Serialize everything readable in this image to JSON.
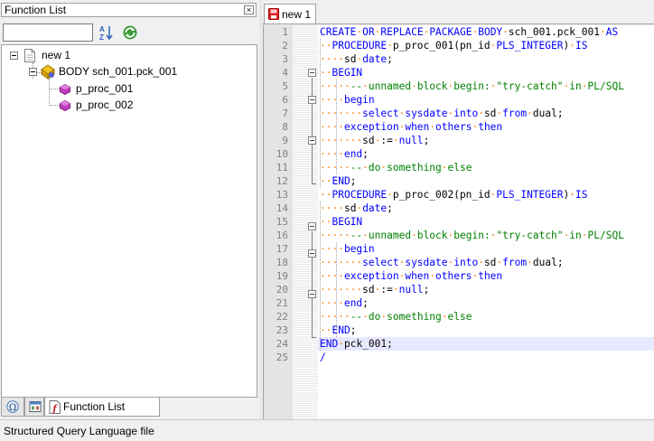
{
  "function_list": {
    "title": "Function List",
    "close_glyph": "×",
    "search": {
      "value": "",
      "placeholder": ""
    },
    "sort_icon": "sort-az-icon",
    "refresh_icon": "refresh-icon",
    "tree": {
      "root": {
        "label": "new 1",
        "icon": "document-icon"
      },
      "package": {
        "label": "BODY sch_001.pck_001",
        "icon": "package-body-icon"
      },
      "procedures": [
        {
          "label": "p_proc_001",
          "icon": "procedure-icon"
        },
        {
          "label": "p_proc_002",
          "icon": "procedure-icon"
        }
      ]
    },
    "tabs": [
      {
        "label": "",
        "icon": "omega-icon"
      },
      {
        "label": "",
        "icon": "project-icon"
      },
      {
        "label": "Function List",
        "icon": "function-list-icon",
        "active": true
      }
    ]
  },
  "editor": {
    "tab_label": "new 1",
    "tab_icon": "unsaved-file-icon",
    "caret_line": 24,
    "lines": [
      "1",
      "2",
      "3",
      "4",
      "5",
      "6",
      "7",
      "8",
      "9",
      "10",
      "11",
      "12",
      "13",
      "14",
      "15",
      "16",
      "17",
      "18",
      "19",
      "20",
      "21",
      "22",
      "23",
      "24",
      "25"
    ]
  },
  "status_bar": {
    "text": "Structured Query Language file"
  },
  "colors": {
    "keyword": "#0000ff",
    "comment": "#008000",
    "whitespace_dot": "#ff8000",
    "caret_line": "#e8e8ff",
    "gutter": "#e4e4e4"
  }
}
